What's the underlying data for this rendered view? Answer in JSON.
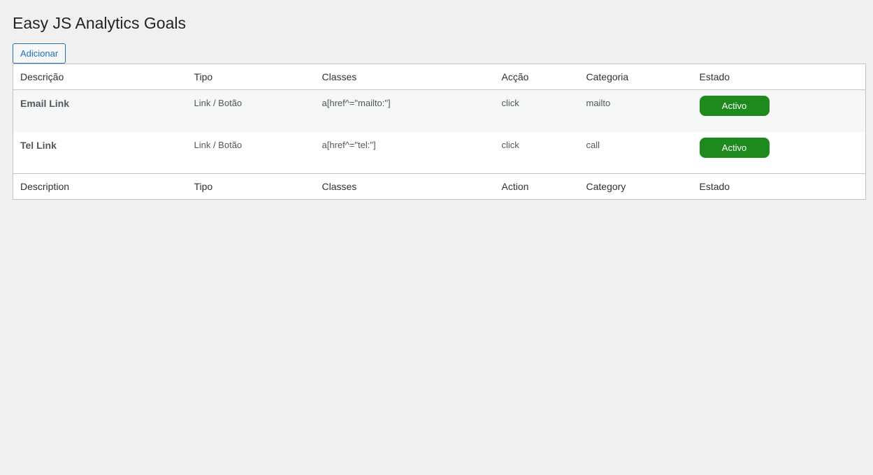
{
  "page": {
    "title": "Easy JS Analytics Goals",
    "add_button_label": "Adicionar"
  },
  "table": {
    "header": {
      "description": "Descrição",
      "type": "Tipo",
      "classes": "Classes",
      "action": "Acção",
      "category": "Categoria",
      "status": "Estado"
    },
    "rows": [
      {
        "description": "Email Link",
        "type": "Link / Botão",
        "classes": "a[href^=\"mailto:\"]",
        "action": "click",
        "category": "mailto",
        "status": "Activo"
      },
      {
        "description": "Tel Link",
        "type": "Link / Botão",
        "classes": "a[href^=\"tel:\"]",
        "action": "click",
        "category": "call",
        "status": "Activo"
      }
    ],
    "footer": {
      "description": "Description",
      "type": "Tipo",
      "classes": "Classes",
      "action": "Action",
      "category": "Category",
      "status": "Estado"
    }
  },
  "colors": {
    "background": "#f0f0f1",
    "accent": "#2271b1",
    "status_active": "#1e8a1e"
  }
}
